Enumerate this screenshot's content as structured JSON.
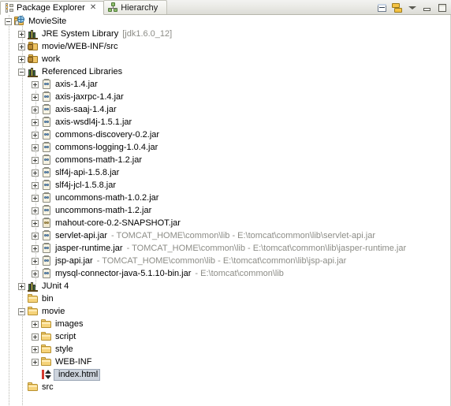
{
  "tabs": [
    {
      "label": "Package Explorer",
      "icon": "package-explorer-icon",
      "active": true,
      "close": "✕"
    },
    {
      "label": "Hierarchy",
      "icon": "hierarchy-icon",
      "active": false,
      "close": ""
    }
  ],
  "view_toolbar": [
    {
      "name": "collapse-all-button",
      "tooltip": "Collapse All"
    },
    {
      "name": "link-with-editor-button",
      "tooltip": "Link with Editor"
    },
    {
      "name": "view-menu-button",
      "tooltip": "View Menu"
    },
    {
      "name": "minimize-button",
      "tooltip": "Minimize"
    },
    {
      "name": "maximize-button",
      "tooltip": "Maximize"
    }
  ],
  "colors": {
    "selection_fill": "#cdd4dd",
    "selection_border": "#9aa5b4",
    "secondary_text": "#8c8c86",
    "tab_active_bg": "#ffffff",
    "tree_bg": "#ffffff"
  },
  "tree": [
    {
      "depth": 0,
      "state": "expanded",
      "icon": "web-project-icon",
      "label": "MovieSite",
      "detail": "",
      "selected": false
    },
    {
      "depth": 1,
      "state": "collapsed",
      "icon": "library-icon",
      "label": "JRE System Library",
      "detail": "[jdk1.6.0_12]",
      "selected": false
    },
    {
      "depth": 1,
      "state": "collapsed",
      "icon": "source-folder-icon",
      "label": "movie/WEB-INF/src",
      "detail": "",
      "selected": false
    },
    {
      "depth": 1,
      "state": "collapsed",
      "icon": "source-folder-icon",
      "label": "work",
      "detail": "",
      "selected": false
    },
    {
      "depth": 1,
      "state": "expanded",
      "icon": "library-icon",
      "label": "Referenced Libraries",
      "detail": "",
      "selected": false
    },
    {
      "depth": 2,
      "state": "collapsed",
      "icon": "jar-icon",
      "label": "axis-1.4.jar",
      "detail": "",
      "selected": false
    },
    {
      "depth": 2,
      "state": "collapsed",
      "icon": "jar-icon",
      "label": "axis-jaxrpc-1.4.jar",
      "detail": "",
      "selected": false
    },
    {
      "depth": 2,
      "state": "collapsed",
      "icon": "jar-icon",
      "label": "axis-saaj-1.4.jar",
      "detail": "",
      "selected": false
    },
    {
      "depth": 2,
      "state": "collapsed",
      "icon": "jar-icon",
      "label": "axis-wsdl4j-1.5.1.jar",
      "detail": "",
      "selected": false
    },
    {
      "depth": 2,
      "state": "collapsed",
      "icon": "jar-icon",
      "label": "commons-discovery-0.2.jar",
      "detail": "",
      "selected": false
    },
    {
      "depth": 2,
      "state": "collapsed",
      "icon": "jar-icon",
      "label": "commons-logging-1.0.4.jar",
      "detail": "",
      "selected": false
    },
    {
      "depth": 2,
      "state": "collapsed",
      "icon": "jar-icon",
      "label": "commons-math-1.2.jar",
      "detail": "",
      "selected": false
    },
    {
      "depth": 2,
      "state": "collapsed",
      "icon": "jar-icon",
      "label": "slf4j-api-1.5.8.jar",
      "detail": "",
      "selected": false
    },
    {
      "depth": 2,
      "state": "collapsed",
      "icon": "jar-icon",
      "label": "slf4j-jcl-1.5.8.jar",
      "detail": "",
      "selected": false
    },
    {
      "depth": 2,
      "state": "collapsed",
      "icon": "jar-icon",
      "label": "uncommons-math-1.0.2.jar",
      "detail": "",
      "selected": false
    },
    {
      "depth": 2,
      "state": "collapsed",
      "icon": "jar-icon",
      "label": "uncommons-math-1.2.jar",
      "detail": "",
      "selected": false
    },
    {
      "depth": 2,
      "state": "collapsed",
      "icon": "jar-icon-variant",
      "label": "mahout-core-0.2-SNAPSHOT.jar",
      "detail": "",
      "selected": false
    },
    {
      "depth": 2,
      "state": "collapsed",
      "icon": "jar-icon",
      "label": "servlet-api.jar",
      "detail": "- TOMCAT_HOME\\common\\lib - E:\\tomcat\\common\\lib\\servlet-api.jar",
      "selected": false
    },
    {
      "depth": 2,
      "state": "collapsed",
      "icon": "jar-icon",
      "label": "jasper-runtime.jar",
      "detail": "- TOMCAT_HOME\\common\\lib - E:\\tomcat\\common\\lib\\jasper-runtime.jar",
      "selected": false
    },
    {
      "depth": 2,
      "state": "collapsed",
      "icon": "jar-icon",
      "label": "jsp-api.jar",
      "detail": "- TOMCAT_HOME\\common\\lib - E:\\tomcat\\common\\lib\\jsp-api.jar",
      "selected": false
    },
    {
      "depth": 2,
      "state": "collapsed",
      "icon": "jar-icon",
      "label": "mysql-connector-java-5.1.10-bin.jar",
      "detail": "- E:\\tomcat\\common\\lib",
      "selected": false
    },
    {
      "depth": 1,
      "state": "collapsed",
      "icon": "library-icon",
      "label": "JUnit 4",
      "detail": "",
      "selected": false
    },
    {
      "depth": 1,
      "state": "leaf",
      "icon": "folder-icon",
      "label": "bin",
      "detail": "",
      "selected": false
    },
    {
      "depth": 1,
      "state": "expanded",
      "icon": "folder-icon",
      "label": "movie",
      "detail": "",
      "selected": false
    },
    {
      "depth": 2,
      "state": "collapsed",
      "icon": "folder-icon",
      "label": "images",
      "detail": "",
      "selected": false
    },
    {
      "depth": 2,
      "state": "collapsed",
      "icon": "folder-icon",
      "label": "script",
      "detail": "",
      "selected": false
    },
    {
      "depth": 2,
      "state": "collapsed",
      "icon": "folder-icon",
      "label": "style",
      "detail": "",
      "selected": false
    },
    {
      "depth": 2,
      "state": "collapsed",
      "icon": "folder-icon",
      "label": "WEB-INF",
      "detail": "",
      "selected": false
    },
    {
      "depth": 2,
      "state": "leaf",
      "icon": "html-file-icon",
      "label": "index.html",
      "detail": "",
      "selected": true
    },
    {
      "depth": 1,
      "state": "leaf",
      "icon": "folder-icon",
      "label": "src",
      "detail": "",
      "selected": false
    }
  ]
}
